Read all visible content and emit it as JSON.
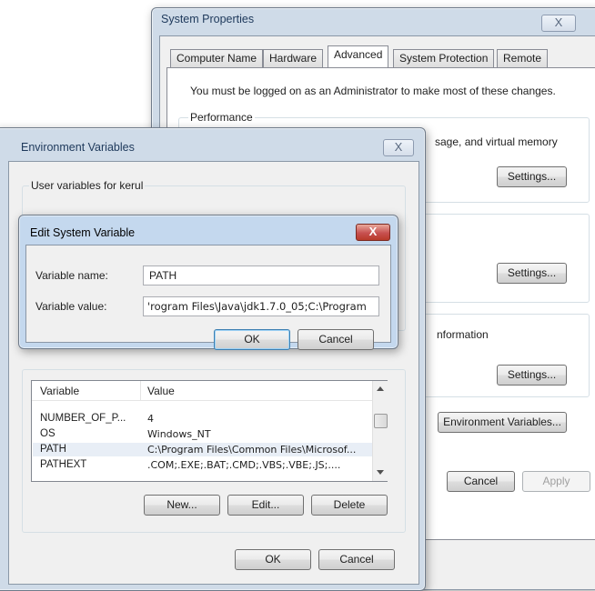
{
  "system_properties": {
    "title": "System Properties",
    "close_label": "X",
    "tabs": [
      "Computer Name",
      "Hardware",
      "Advanced",
      "System Protection",
      "Remote"
    ],
    "notice": "You must be logged on as an Administrator to make most of these changes.",
    "performance_group": "Performance",
    "performance_desc": "sage, and virtual memory",
    "settings_label": "Settings...",
    "startup_desc": "nformation",
    "env_vars_button": "Environment Variables...",
    "cancel_label": "Cancel",
    "apply_label": "Apply"
  },
  "environment_variables": {
    "title": "Environment Variables",
    "close_label": "X",
    "user_group": "User variables for kerul",
    "list_headers": [
      "Variable",
      "Value"
    ],
    "rows": [
      {
        "variable": "NUMBER_OF_P...",
        "value": "4"
      },
      {
        "variable": "OS",
        "value": "Windows_NT"
      },
      {
        "variable": "PATH",
        "value": "C:\\Program Files\\Common Files\\Microsof..."
      },
      {
        "variable": "PATHEXT",
        "value": ".COM;.EXE;.BAT;.CMD;.VBS;.VBE;.JS;...."
      }
    ],
    "new_label": "New...",
    "edit_label": "Edit...",
    "delete_label": "Delete",
    "ok_label": "OK",
    "cancel_label": "Cancel"
  },
  "edit_system_variable": {
    "title": "Edit System Variable",
    "close_label": "X",
    "name_label": "Variable name:",
    "name_value": "PATH",
    "value_label": "Variable value:",
    "value_value": "'rogram Files\\Java\\jdk1.7.0_05;C:\\Program",
    "ok_label": "OK",
    "cancel_label": "Cancel"
  }
}
